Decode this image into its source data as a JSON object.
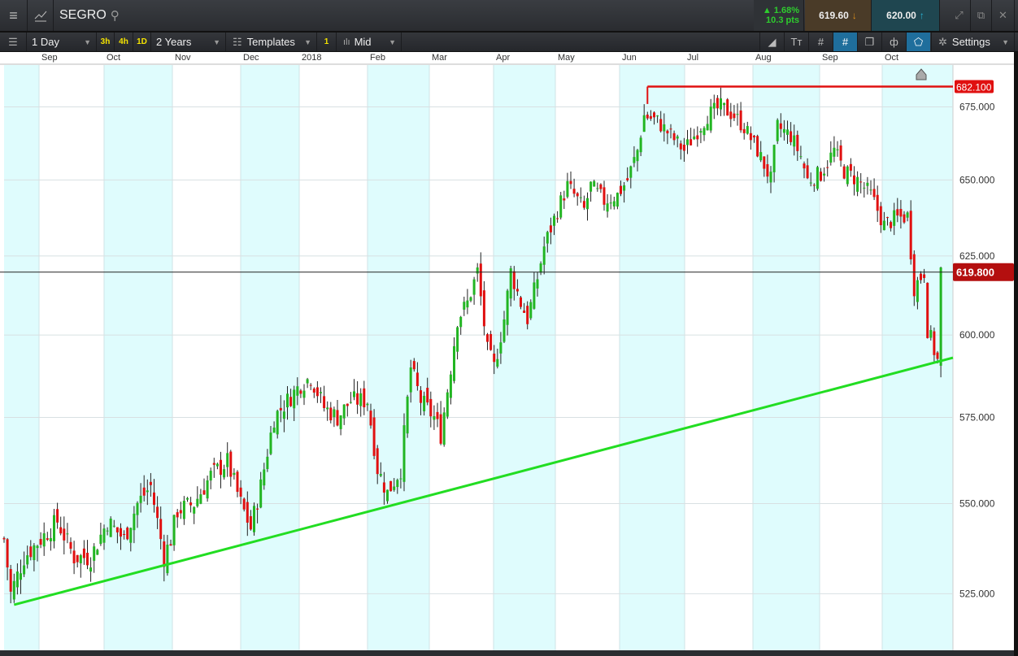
{
  "header": {
    "symbol": "SEGRO",
    "change_pct": "▲ 1.68%",
    "change_pts": "10.3 pts",
    "sell": "619.60",
    "buy": "620.00"
  },
  "toolbar": {
    "interval": "1 Day",
    "quick": [
      "3h",
      "4h",
      "1D"
    ],
    "range": "2 Years",
    "templates": "Templates",
    "count": "1",
    "price_type": "Mid",
    "settings": "Settings"
  },
  "colors": {
    "up": "#22b522",
    "down": "#e01010",
    "band": "#dffcfd",
    "support": "#22dd22",
    "resistance": "#e01010"
  },
  "chart_data": {
    "type": "candlestick",
    "x_ticks": [
      "Sep",
      "Oct",
      "Nov",
      "Dec",
      "2018",
      "Feb",
      "Mar",
      "Apr",
      "May",
      "Jun",
      "Jul",
      "Aug",
      "Sep",
      "Oct"
    ],
    "y_ticks": [
      "525.000",
      "550.000",
      "575.000",
      "600.000",
      "625.000",
      "650.000",
      "675.000"
    ],
    "y_tick_values": [
      525,
      550,
      575,
      600,
      625,
      650,
      675
    ],
    "ylim": [
      505,
      690
    ],
    "scale": "log",
    "days": 282,
    "close_waypoints": [
      [
        0,
        540
      ],
      [
        2,
        525
      ],
      [
        6,
        535
      ],
      [
        11,
        540
      ],
      [
        16,
        545
      ],
      [
        21,
        535
      ],
      [
        26,
        535
      ],
      [
        31,
        545
      ],
      [
        36,
        540
      ],
      [
        40,
        550
      ],
      [
        44,
        555
      ],
      [
        48,
        535
      ],
      [
        50,
        540
      ],
      [
        52,
        548
      ],
      [
        57,
        550
      ],
      [
        62,
        558
      ],
      [
        67,
        562
      ],
      [
        71,
        550
      ],
      [
        74,
        543
      ],
      [
        77,
        555
      ],
      [
        81,
        575
      ],
      [
        85,
        580
      ],
      [
        89,
        585
      ],
      [
        92,
        587
      ],
      [
        96,
        578
      ],
      [
        100,
        575
      ],
      [
        104,
        580
      ],
      [
        109,
        580
      ],
      [
        112,
        560
      ],
      [
        115,
        553
      ],
      [
        119,
        560
      ],
      [
        122,
        590
      ],
      [
        125,
        580
      ],
      [
        129,
        575
      ],
      [
        131,
        570
      ],
      [
        134,
        590
      ],
      [
        136,
        605
      ],
      [
        139,
        610
      ],
      [
        142,
        620
      ],
      [
        145,
        595
      ],
      [
        147,
        590
      ],
      [
        150,
        605
      ],
      [
        152,
        620
      ],
      [
        155,
        610
      ],
      [
        157,
        605
      ],
      [
        160,
        618
      ],
      [
        162,
        628
      ],
      [
        166,
        640
      ],
      [
        169,
        648
      ],
      [
        171,
        645
      ],
      [
        174,
        640
      ],
      [
        176,
        648
      ],
      [
        180,
        643
      ],
      [
        184,
        645
      ],
      [
        187,
        650
      ],
      [
        190,
        660
      ],
      [
        192,
        672
      ],
      [
        196,
        670
      ],
      [
        200,
        665
      ],
      [
        204,
        660
      ],
      [
        207,
        665
      ],
      [
        211,
        672
      ],
      [
        215,
        675
      ],
      [
        219,
        672
      ],
      [
        222,
        668
      ],
      [
        226,
        660
      ],
      [
        230,
        650
      ],
      [
        232,
        668
      ],
      [
        236,
        665
      ],
      [
        239,
        658
      ],
      [
        241,
        650
      ],
      [
        245,
        652
      ],
      [
        249,
        660
      ],
      [
        252,
        653
      ],
      [
        256,
        650
      ],
      [
        260,
        645
      ],
      [
        264,
        635
      ],
      [
        267,
        637
      ],
      [
        271,
        638
      ],
      [
        273,
        615
      ],
      [
        276,
        620
      ],
      [
        277,
        602
      ],
      [
        280,
        592
      ],
      [
        281,
        620
      ]
    ],
    "support_line": {
      "from": [
        3,
        522
      ],
      "to": [
        292,
        593
      ]
    },
    "resistance_level": "682.100",
    "resistance_start_day": 193,
    "current_price": "619.800"
  }
}
